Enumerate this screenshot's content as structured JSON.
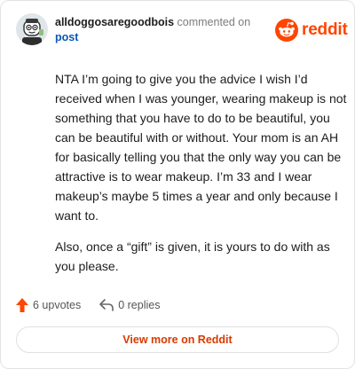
{
  "header": {
    "username": "alldoggosaregoodbois",
    "commented_text": "commented on",
    "post_link": "post"
  },
  "brand": {
    "name": "reddit",
    "color": "#ff4500",
    "icon": "reddit-logo-icon"
  },
  "comment": {
    "paragraphs": [
      "NTA I’m going to give you the advice I wish I’d received when I was younger, wearing makeup is not something that you have to do to be beautiful, you can be beautiful with or without. Your mom is an AH for basically telling you that the only way you can be attractive is to wear makeup. I’m 33 and I wear makeup’s maybe 5 times a year and only because I want to.",
      "Also, once a “gift” is given, it is yours to do with as you please."
    ]
  },
  "actions": {
    "upvotes_label": "6 upvotes",
    "upvote_icon": "upvote-arrow-icon",
    "upvote_color": "#ff4500",
    "replies_label": "0 replies",
    "reply_icon": "reply-arrow-icon"
  },
  "footer": {
    "view_more_label": "View more on Reddit",
    "accent_color": "#d93a00"
  }
}
